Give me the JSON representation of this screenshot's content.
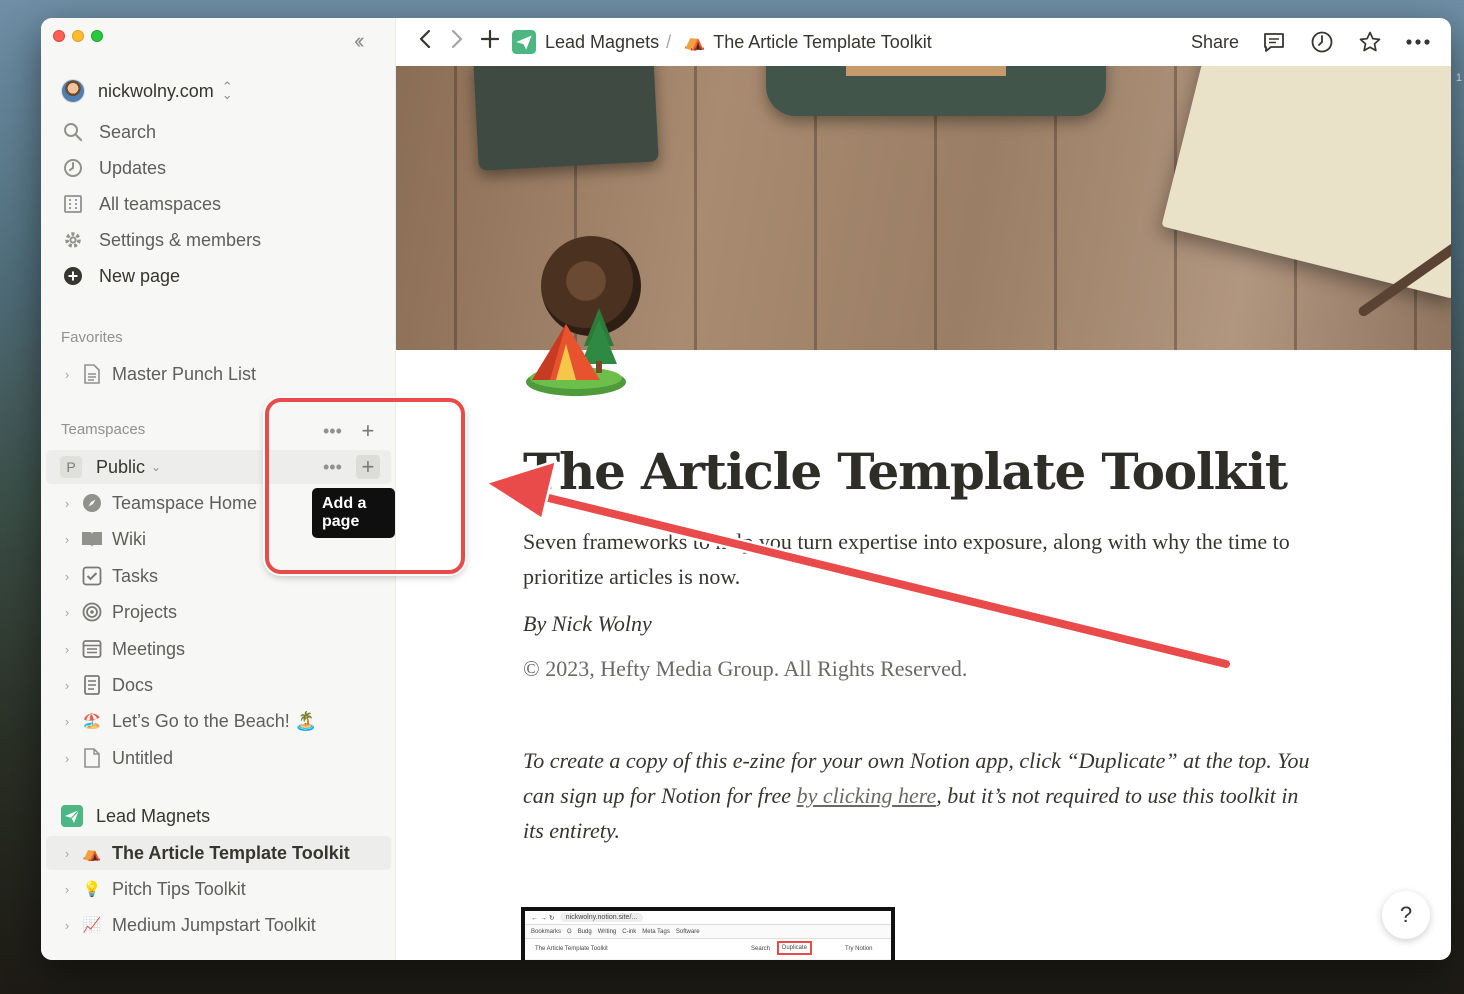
{
  "workspace": {
    "name": "nickwolny.com"
  },
  "nav": [
    {
      "label": "Search",
      "icon": "search-icon"
    },
    {
      "label": "Updates",
      "icon": "clock-icon"
    },
    {
      "label": "All teamspaces",
      "icon": "building-icon"
    },
    {
      "label": "Settings & members",
      "icon": "gear-icon"
    },
    {
      "label": "New page",
      "icon": "plus-circle-icon"
    }
  ],
  "favorites": {
    "title": "Favorites",
    "items": [
      {
        "label": "Master Punch List",
        "icon": "document-icon"
      }
    ]
  },
  "teamspaces": {
    "title": "Teamspaces",
    "public": {
      "badge": "P",
      "label": "Public"
    },
    "items": [
      {
        "label": "Teamspace Home",
        "icon": "compass-icon"
      },
      {
        "label": "Wiki",
        "icon": "book-icon"
      },
      {
        "label": "Tasks",
        "icon": "checkbox-icon"
      },
      {
        "label": "Projects",
        "icon": "target-icon"
      },
      {
        "label": "Meetings",
        "icon": "calendar-icon"
      },
      {
        "label": "Docs",
        "icon": "document-icon"
      },
      {
        "label": "Let’s Go to the Beach! 🏝️",
        "icon": "beach-icon",
        "emoji": "🏖️"
      },
      {
        "label": "Untitled",
        "icon": "document-icon"
      }
    ],
    "lead_magnets": {
      "label": "Lead Magnets",
      "items": [
        {
          "label": "The Article Template Toolkit",
          "emoji": "⛺"
        },
        {
          "label": "Pitch Tips Toolkit",
          "emoji": "💡"
        },
        {
          "label": "Medium Jumpstart Toolkit",
          "emoji": "📈"
        }
      ]
    }
  },
  "tooltip": "Add a page",
  "breadcrumb": {
    "parent": "Lead Magnets",
    "separator": "/",
    "current": "The Article Template Toolkit"
  },
  "topbar": {
    "share": "Share"
  },
  "page": {
    "title": "The Article Template Toolkit",
    "subtitle": "Seven frameworks to help you turn expertise into exposure, along with why the time to prioritize articles is now.",
    "byline": "By Nick Wolny",
    "copyright": "© 2023, Hefty Media Group. All Rights Reserved.",
    "instructions_before": "To create a copy of this e-zine for your own Notion app, click “Duplicate” at the top. You can sign up for Notion for free ",
    "instructions_link": "by clicking here",
    "instructions_after": ", but it’s not required to use this toolkit in its entirety."
  },
  "thumbnail": {
    "url": "nickwolny.notion.site/...",
    "bookmarks": [
      "Bookmarks",
      "G",
      "Budg",
      "Writing",
      "C-ink",
      "Meta Tags",
      "Software"
    ],
    "page": "The Article Template Toolkit",
    "search": "Search",
    "duplicate": "Duplicate",
    "try": "Try Notion"
  },
  "help": "?",
  "colors": {
    "accent_red": "#e94b4b",
    "sidebar_bg": "#f7f7f5",
    "lead_magnets_icon": "#4cb782"
  }
}
